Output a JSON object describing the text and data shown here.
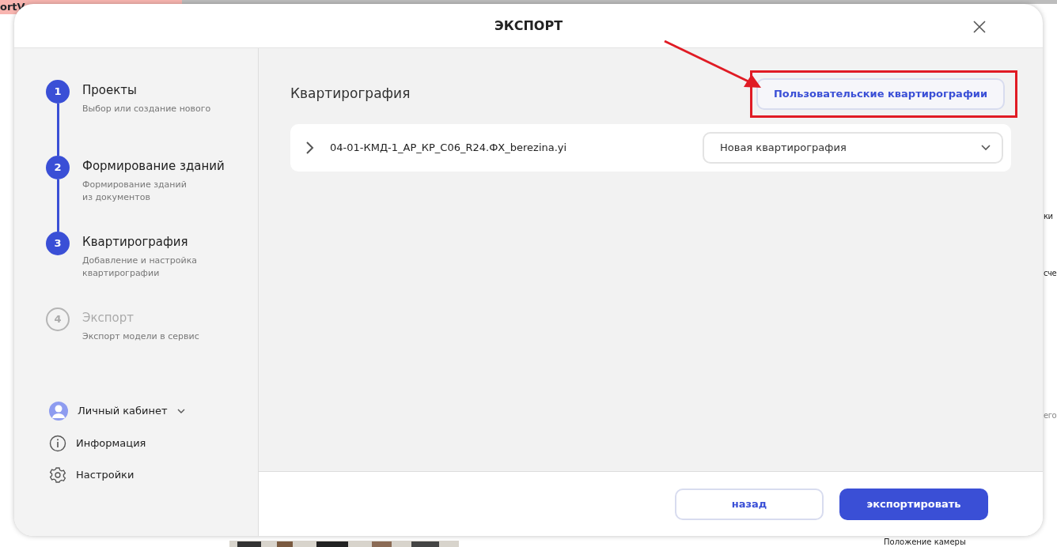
{
  "background": {
    "app_title": "ortV",
    "side_texts": [
      "ки",
      "сче",
      "его"
    ],
    "bottom_text": "Положение камеры"
  },
  "dialog": {
    "title": "ЭКСПОРТ",
    "steps": [
      {
        "number": "1",
        "title": "Проекты",
        "subtitle": "Выбор или создание нового",
        "active": true
      },
      {
        "number": "2",
        "title": "Формирование зданий",
        "subtitle": "Формирование зданий\nиз документов",
        "active": true
      },
      {
        "number": "3",
        "title": "Квартирография",
        "subtitle": "Добавление и настройка\nквартирографии",
        "active": true
      },
      {
        "number": "4",
        "title": "Экспорт",
        "subtitle": "Экспорт модели в сервис",
        "active": false
      }
    ],
    "sidebar_links": [
      {
        "kind": "account",
        "label": "Личный кабинет"
      },
      {
        "kind": "info",
        "label": "Информация"
      },
      {
        "kind": "settings",
        "label": "Настройки"
      }
    ],
    "section_title": "Квартирография",
    "custom_button": "Пользовательские квартирографии",
    "files": [
      {
        "name": "04-01-КМД-1_АР_КР_С06_R24.ФХ_berezina.yi",
        "expanded": false,
        "select_value": "Новая квартирография"
      }
    ],
    "buttons": {
      "back": "назад",
      "export": "экспортировать"
    }
  }
}
